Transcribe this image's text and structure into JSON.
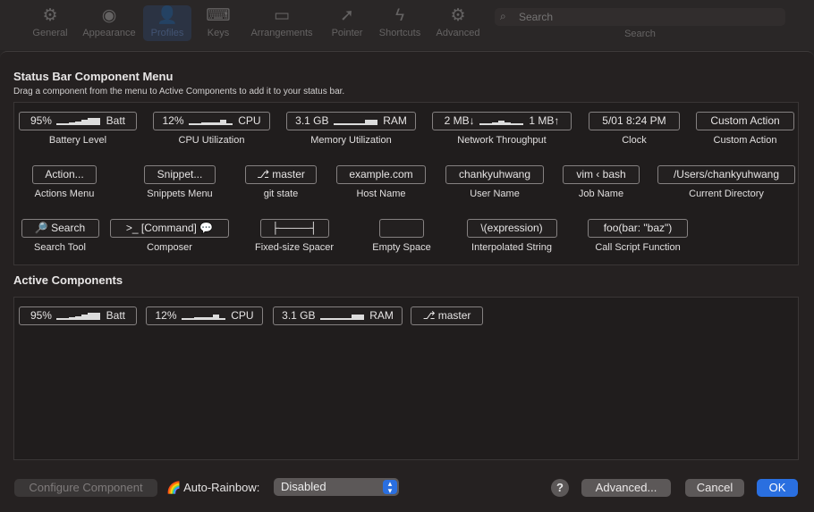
{
  "toolbar": {
    "items": [
      {
        "label": "General",
        "icon": "gear-icon",
        "glyph": "⚙"
      },
      {
        "label": "Appearance",
        "icon": "eye-icon",
        "glyph": "◉"
      },
      {
        "label": "Profiles",
        "icon": "person-icon",
        "glyph": "👤"
      },
      {
        "label": "Keys",
        "icon": "keyboard-icon",
        "glyph": "⌨"
      },
      {
        "label": "Arrangements",
        "icon": "window-icon",
        "glyph": "▭"
      },
      {
        "label": "Pointer",
        "icon": "pointer-icon",
        "glyph": "➚"
      },
      {
        "label": "Shortcuts",
        "icon": "bolt-icon",
        "glyph": "ϟ"
      },
      {
        "label": "Advanced",
        "icon": "gears-icon",
        "glyph": "⚙"
      }
    ],
    "selected": "Profiles",
    "search_placeholder": "Search",
    "search_label": "Search"
  },
  "menu_section": {
    "title": "Status Bar Component Menu",
    "subtitle": "Drag a component from the menu to Active Components to add it to your status bar.",
    "components": [
      {
        "pill_pre": "95%",
        "pill_post": "Batt",
        "bars": true,
        "label": "Battery Level"
      },
      {
        "pill_pre": "12%",
        "pill_post": "CPU",
        "bars": true,
        "label": "CPU Utilization"
      },
      {
        "pill_pre": "3.1 GB",
        "pill_post": "RAM",
        "bars": true,
        "label": "Memory Utilization"
      },
      {
        "pill_pre": "2 MB↓",
        "pill_post": "1 MB↑",
        "bars": true,
        "label": "Network Throughput"
      },
      {
        "pill": "5/01 8:24 PM",
        "label": "Clock"
      },
      {
        "pill": "Custom Action",
        "label": "Custom Action"
      },
      {
        "pill": "Action...",
        "label": "Actions Menu"
      },
      {
        "pill": "Snippet...",
        "label": "Snippets Menu"
      },
      {
        "pill": "⎇ master",
        "label": "git state"
      },
      {
        "pill": "example.com",
        "label": "Host Name"
      },
      {
        "pill": "chankyuhwang",
        "label": "User Name"
      },
      {
        "pill": "vim ‹ bash",
        "label": "Job Name"
      },
      {
        "pill": "/Users/chankyuhwang",
        "label": "Current Directory"
      },
      {
        "pill": "🔎 Search",
        "label": "Search Tool"
      },
      {
        "pill": ">_ [Command] 💬",
        "label": "Composer"
      },
      {
        "pill": "├────┤",
        "label": "Fixed-size Spacer"
      },
      {
        "pill": "",
        "label": "Empty Space"
      },
      {
        "pill": "\\(expression)",
        "label": "Interpolated String"
      },
      {
        "pill": "foo(bar: \"baz\")",
        "label": "Call Script Function"
      }
    ]
  },
  "active_section": {
    "title": "Active Components",
    "items": [
      {
        "pill_pre": "95%",
        "pill_post": "Batt"
      },
      {
        "pill_pre": "12%",
        "pill_post": "CPU"
      },
      {
        "pill_pre": "3.1 GB",
        "pill_post": "RAM"
      },
      {
        "pill": "⎇ master"
      }
    ]
  },
  "footer": {
    "configure_label": "Configure Component",
    "rainbow_icon": "🌈",
    "rainbow_label": "Auto-Rainbow:",
    "rainbow_value": "Disabled",
    "help_label": "?",
    "advanced_label": "Advanced...",
    "cancel_label": "Cancel",
    "ok_label": "OK"
  },
  "colors": {
    "accent": "#2a6fe0",
    "background": "#252121"
  }
}
